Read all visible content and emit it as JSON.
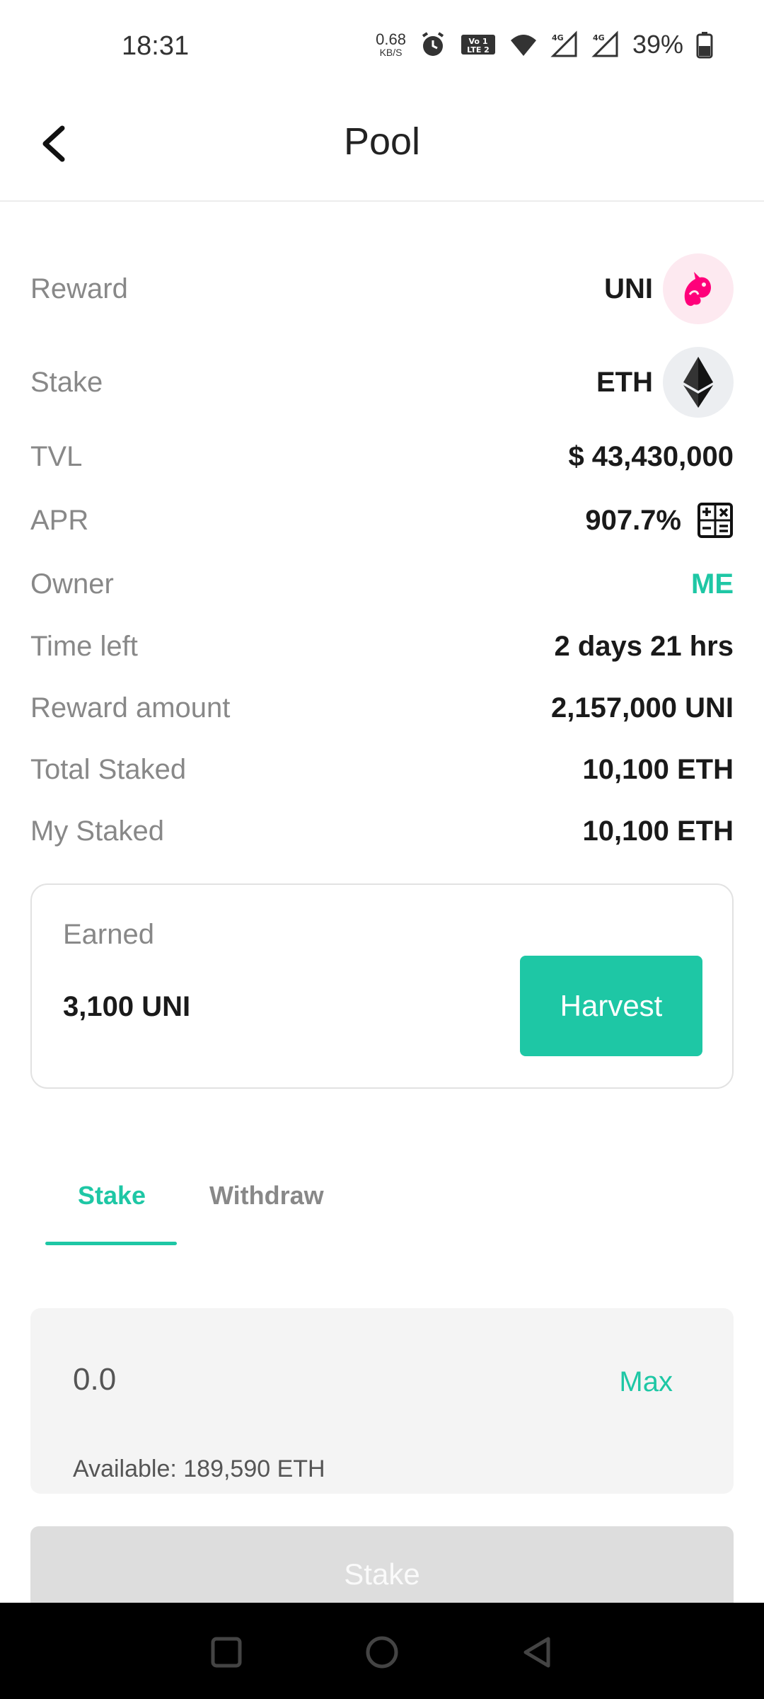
{
  "status_bar": {
    "time": "18:31",
    "net_speed": "0.68",
    "net_unit": "KB/S",
    "battery": "39%"
  },
  "header": {
    "title": "Pool"
  },
  "info": {
    "reward": {
      "label": "Reward",
      "value": "UNI"
    },
    "stake": {
      "label": "Stake",
      "value": "ETH"
    },
    "tvl": {
      "label": "TVL",
      "value": "$ 43,430,000"
    },
    "apr": {
      "label": "APR",
      "value": "907.7%"
    },
    "owner": {
      "label": "Owner",
      "value": "ME"
    },
    "time_left": {
      "label": "Time left",
      "value": "2 days 21 hrs"
    },
    "reward_amount": {
      "label": "Reward amount",
      "value": "2,157,000 UNI"
    },
    "total_staked": {
      "label": "Total Staked",
      "value": "10,100 ETH"
    },
    "my_staked": {
      "label": "My Staked",
      "value": "10,100 ETH"
    }
  },
  "earned": {
    "label": "Earned",
    "value": "3,100 UNI",
    "harvest_label": "Harvest"
  },
  "tabs": [
    {
      "label": "Stake",
      "active": true
    },
    {
      "label": "Withdraw",
      "active": false
    }
  ],
  "amount": {
    "value": "0.0",
    "max_label": "Max",
    "available": "Available: 189,590 ETH"
  },
  "stake_button": {
    "label": "Stake"
  },
  "colors": {
    "accent": "#1ec7a5",
    "uni_pink": "#ff007a",
    "muted": "#888888"
  },
  "icons": {
    "reward_token": "unicorn-icon",
    "stake_token": "ethereum-icon",
    "apr_calc": "calculator-icon"
  }
}
